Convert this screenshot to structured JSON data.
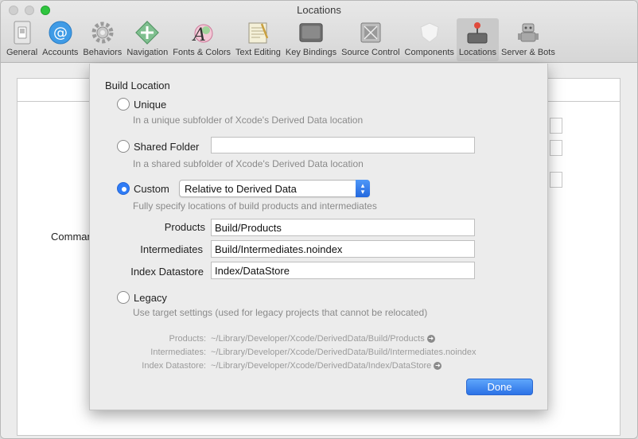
{
  "window": {
    "title": "Locations"
  },
  "toolbar": {
    "items": [
      {
        "label": "General",
        "icon": "switch-icon"
      },
      {
        "label": "Accounts",
        "icon": "at-sign-icon"
      },
      {
        "label": "Behaviors",
        "icon": "gear-icon"
      },
      {
        "label": "Navigation",
        "icon": "arrows-icon"
      },
      {
        "label": "Fonts & Colors",
        "icon": "font-icon"
      },
      {
        "label": "Text Editing",
        "icon": "notepad-icon"
      },
      {
        "label": "Key Bindings",
        "icon": "key-icon"
      },
      {
        "label": "Source Control",
        "icon": "source-control-icon"
      },
      {
        "label": "Components",
        "icon": "shield-icon"
      },
      {
        "label": "Locations",
        "icon": "joystick-icon"
      },
      {
        "label": "Server & Bots",
        "icon": "robot-icon"
      }
    ],
    "active": "Locations"
  },
  "background": {
    "partial_label": "Comman"
  },
  "sheet": {
    "title": "Build Location",
    "options": {
      "unique": {
        "label": "Unique",
        "hint": "In a unique subfolder of Xcode's Derived Data location",
        "checked": false
      },
      "shared": {
        "label": "Shared Folder",
        "hint": "In a shared subfolder of Xcode's Derived Data location",
        "value": "",
        "checked": false
      },
      "custom": {
        "label": "Custom",
        "hint": "Fully specify locations of build products and intermediates",
        "checked": true,
        "popup_value": "Relative to Derived Data"
      },
      "legacy": {
        "label": "Legacy",
        "hint": "Use target settings (used for legacy projects that cannot be relocated)",
        "checked": false
      }
    },
    "fields": {
      "products": {
        "label": "Products",
        "value": "Build/Products"
      },
      "intermediates": {
        "label": "Intermediates",
        "value": "Build/Intermediates.noindex"
      },
      "index": {
        "label": "Index Datastore",
        "value": "Index/DataStore"
      }
    },
    "paths": {
      "products": {
        "label": "Products:",
        "value": "~/Library/Developer/Xcode/DerivedData/Build/Products"
      },
      "intermediates": {
        "label": "Intermediates:",
        "value": "~/Library/Developer/Xcode/DerivedData/Build/Intermediates.noindex"
      },
      "index": {
        "label": "Index Datastore:",
        "value": "~/Library/Developer/Xcode/DerivedData/Index/DataStore"
      }
    },
    "done_label": "Done"
  },
  "colors": {
    "accent": "#2f7cf6",
    "hint": "#8a8a8a"
  }
}
